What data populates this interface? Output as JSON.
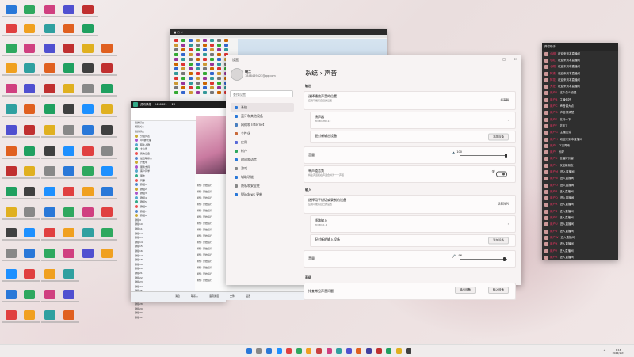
{
  "settings_window": {
    "title": "设置",
    "user_name": "啊二",
    "user_email": "1848469423@qq.com",
    "search_placeholder": "查找设置",
    "nav": [
      {
        "label": "系统",
        "color": "#2a78d8"
      },
      {
        "label": "蓝牙和其他设备",
        "color": "#2a78d8"
      },
      {
        "label": "网络和 Internet",
        "color": "#4a7fc0"
      },
      {
        "label": "个性化",
        "color": "#c96a3a"
      },
      {
        "label": "应用",
        "color": "#5a6ad8"
      },
      {
        "label": "帐户",
        "color": "#2fa85f"
      },
      {
        "label": "时间和语言",
        "color": "#2a78d8"
      },
      {
        "label": "游戏",
        "color": "#888888"
      },
      {
        "label": "辅助功能",
        "color": "#2a78d8"
      },
      {
        "label": "隐私和安全性",
        "color": "#888888"
      },
      {
        "label": "Windows 更新",
        "color": "#2a78d8"
      }
    ],
    "breadcrumb": "系统  ›  声音",
    "output_label": "输出",
    "output_choose_title": "选择播放声音的位置",
    "output_choose_sub": "应用可能有自己的设置",
    "output_device_right": "扬声器",
    "speaker_title": "扬声器",
    "speaker_sub": "HDMI1 HD-12",
    "pair_output": "配对新输出设备",
    "add_device_btn": "添加设备",
    "volume_label": "音量",
    "volume_value": "100",
    "mono_title": "单声道音频",
    "mono_sub": "将左声道和右声道合并为一个声道",
    "mono_state": "关",
    "input_label": "输入",
    "input_choose_title": "选择用于讲话或录制的设备",
    "input_choose_sub": "应用可能有自己的设置",
    "input_device_right": "话筒阵列",
    "mic_title": "线路输入",
    "mic_sub": "HDMI1 1.1",
    "pair_input": "配对新的输入设备",
    "input_volume_label": "音量",
    "input_volume_value": "96",
    "advanced_label": "高级",
    "troubleshoot_title": "排查常见声音问题",
    "out_dev_btn": "输出设备",
    "in_dev_btn": "输入设备"
  },
  "chat_window": {
    "title": "资讯风格",
    "members": "2450801",
    "online": "23",
    "group_label": "小明",
    "friends": [
      "我的好友",
      "特别关心",
      "我的好友",
      "分组列表",
      "QQ群管理",
      "陌生人群",
      "大小号",
      "我的设备",
      "最近联系人",
      "开发中",
      "服务支持",
      "客户同学",
      "朋友",
      "同事",
      "群组1",
      "群组2",
      "群组3",
      "群组4",
      "群组5",
      "群组6",
      "群组7",
      "群组8",
      "群组9",
      "群组10",
      "群组11",
      "群组12",
      "群组13",
      "群组14",
      "群组15",
      "群组16",
      "群组17",
      "群组18",
      "群组19",
      "群组20",
      "群组21",
      "群组22",
      "群组23",
      "群组24",
      "群组25",
      "群组26",
      "群组27",
      "群组28",
      "群组29",
      "群组30",
      "群组31"
    ],
    "messages": [
      "通知: 开始运行",
      "通知: 开始运行",
      "通知: 开始运行",
      "通知: 开始运行",
      "通知: 开始运行",
      "通知: 开始运行",
      "通知: 开始运行",
      "通知: 开始运行",
      "通知: 开始运行",
      "通知: 开始运行",
      "通知: 开始运行",
      "通知: 开始运行",
      "通知: 开始运行",
      "通知: 开始运行",
      "通知: 开始运行",
      "通知: 开始运行"
    ],
    "footer_tabs": [
      "消息",
      "联系人",
      "语音通话",
      "文件",
      "设置"
    ]
  },
  "danmaku": {
    "title": "弹幕助手",
    "rows": [
      {
        "user": "小明",
        "text": "欢迎来到本直播间"
      },
      {
        "user": "小红",
        "text": "欢迎来到本直播间"
      },
      {
        "user": "小刚",
        "text": "欢迎来到本直播间"
      },
      {
        "user": "阿杰",
        "text": "欢迎来到本直播间"
      },
      {
        "user": "阿花",
        "text": "欢迎来到本直播间"
      },
      {
        "user": "大壮",
        "text": "欢迎来到本直播间"
      },
      {
        "user": "用户A",
        "text": "这个怎么设置"
      },
      {
        "user": "用户B",
        "text": "主播你好"
      },
      {
        "user": "用户C",
        "text": "声音调大点"
      },
      {
        "user": "用户D",
        "text": "声音很清楚"
      },
      {
        "user": "用户E",
        "text": "支持一下"
      },
      {
        "user": "用户F",
        "text": "学到了"
      },
      {
        "user": "用户G",
        "text": "主播加油"
      },
      {
        "user": "用户H",
        "text": "欢迎来到本直播间"
      },
      {
        "user": "用户I",
        "text": "下次再来"
      },
      {
        "user": "用户J",
        "text": "你好"
      },
      {
        "user": "用户K",
        "text": "主播好厉害"
      },
      {
        "user": "用户L",
        "text": "欢迎新朋友"
      },
      {
        "user": "用户M",
        "text": "进入直播间"
      },
      {
        "user": "用户N",
        "text": "进入直播间"
      },
      {
        "user": "用户O",
        "text": "进入直播间"
      },
      {
        "user": "用户P",
        "text": "进入直播间"
      },
      {
        "user": "用户Q",
        "text": "进入直播间"
      },
      {
        "user": "用户R",
        "text": "进入直播间"
      },
      {
        "user": "用户S",
        "text": "进入直播间"
      },
      {
        "user": "用户T",
        "text": "进入直播间"
      },
      {
        "user": "用户U",
        "text": "进入直播间"
      },
      {
        "user": "用户V",
        "text": "进入直播间"
      },
      {
        "user": "用户W",
        "text": "进入直播间"
      },
      {
        "user": "用户X",
        "text": "进入直播间"
      },
      {
        "user": "用户Y",
        "text": "进入直播间"
      },
      {
        "user": "用户Z",
        "text": "进入直播间"
      }
    ]
  },
  "taskbar": {
    "time": "1:16",
    "date": "2022/1/27",
    "icons": [
      "#2a78d8",
      "#888888",
      "#2a78d8",
      "#1e90ff",
      "#e04040",
      "#2fa85f",
      "#f0a020",
      "#c94040",
      "#d04080",
      "#30a0a0",
      "#5050d0",
      "#e06020",
      "#4040a0",
      "#c03030",
      "#20a060",
      "#e0b020",
      "#404040"
    ]
  }
}
